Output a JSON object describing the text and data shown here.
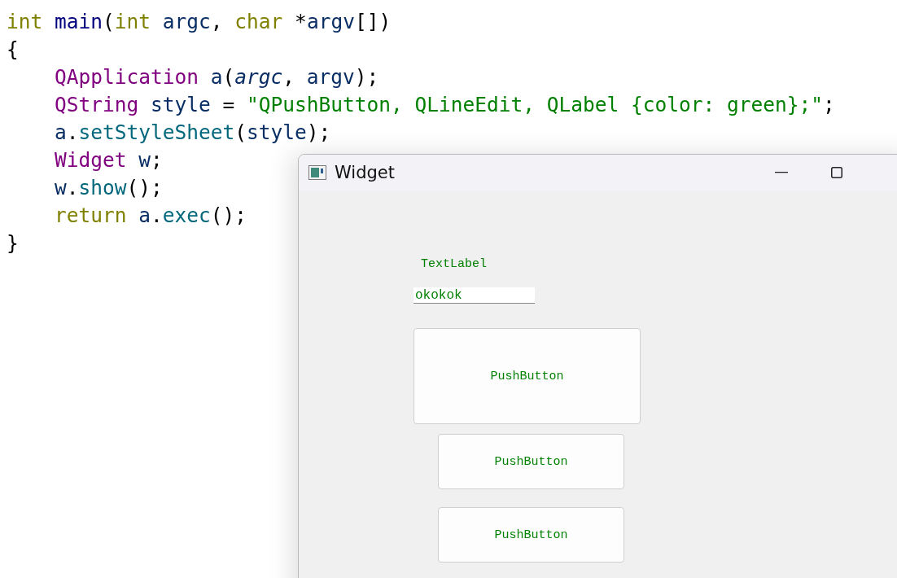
{
  "code_lines": [
    {
      "indent": false,
      "tokens": [
        {
          "kind": "keyword",
          "text": "int "
        },
        {
          "kind": "decl",
          "text": "main"
        },
        {
          "kind": "punct",
          "text": "("
        },
        {
          "kind": "keyword",
          "text": "int"
        },
        {
          "kind": "ident",
          "text": " argc"
        },
        {
          "kind": "punct",
          "text": ", "
        },
        {
          "kind": "keyword",
          "text": "char"
        },
        {
          "kind": "punct",
          "text": " *"
        },
        {
          "kind": "ident",
          "text": "argv"
        },
        {
          "kind": "punct",
          "text": "[])"
        }
      ]
    },
    {
      "indent": false,
      "tokens": [
        {
          "kind": "punct",
          "text": "{"
        }
      ]
    },
    {
      "indent": true,
      "tokens": [
        {
          "kind": "class",
          "text": "QApplication"
        },
        {
          "kind": "ident",
          "text": " a"
        },
        {
          "kind": "punct",
          "text": "("
        },
        {
          "kind": "param",
          "text": "argc"
        },
        {
          "kind": "punct",
          "text": ", "
        },
        {
          "kind": "ident",
          "text": "argv"
        },
        {
          "kind": "punct",
          "text": ");"
        }
      ]
    },
    {
      "indent": true,
      "tokens": [
        {
          "kind": "class",
          "text": "QString"
        },
        {
          "kind": "ident",
          "text": " style"
        },
        {
          "kind": "punct",
          "text": " = "
        },
        {
          "kind": "string",
          "text": "\"QPushButton, QLineEdit, QLabel {color: green};\""
        },
        {
          "kind": "punct",
          "text": ";"
        }
      ]
    },
    {
      "indent": true,
      "tokens": [
        {
          "kind": "ident",
          "text": "a"
        },
        {
          "kind": "punct",
          "text": "."
        },
        {
          "kind": "func",
          "text": "setStyleSheet"
        },
        {
          "kind": "punct",
          "text": "("
        },
        {
          "kind": "ident",
          "text": "style"
        },
        {
          "kind": "punct",
          "text": ");"
        }
      ]
    },
    {
      "indent": true,
      "tokens": [
        {
          "kind": "class",
          "text": "Widget"
        },
        {
          "kind": "ident",
          "text": " w"
        },
        {
          "kind": "punct",
          "text": ";"
        }
      ]
    },
    {
      "indent": true,
      "tokens": [
        {
          "kind": "ident",
          "text": "w"
        },
        {
          "kind": "punct",
          "text": "."
        },
        {
          "kind": "func",
          "text": "show"
        },
        {
          "kind": "punct",
          "text": "();"
        }
      ]
    },
    {
      "indent": true,
      "tokens": [
        {
          "kind": "keyword",
          "text": "return"
        },
        {
          "kind": "ident",
          "text": " a"
        },
        {
          "kind": "punct",
          "text": "."
        },
        {
          "kind": "func",
          "text": "exec"
        },
        {
          "kind": "punct",
          "text": "();"
        }
      ]
    },
    {
      "indent": false,
      "tokens": [
        {
          "kind": "punct",
          "text": "}"
        }
      ]
    }
  ],
  "window": {
    "title": "Widget",
    "widgets": [
      {
        "kind": "label",
        "text": "TextLabel"
      },
      {
        "kind": "line_edit",
        "value": "okokok"
      },
      {
        "kind": "button",
        "text": "PushButton"
      },
      {
        "kind": "button",
        "text": "PushButton"
      },
      {
        "kind": "button",
        "text": "PushButton"
      }
    ]
  }
}
